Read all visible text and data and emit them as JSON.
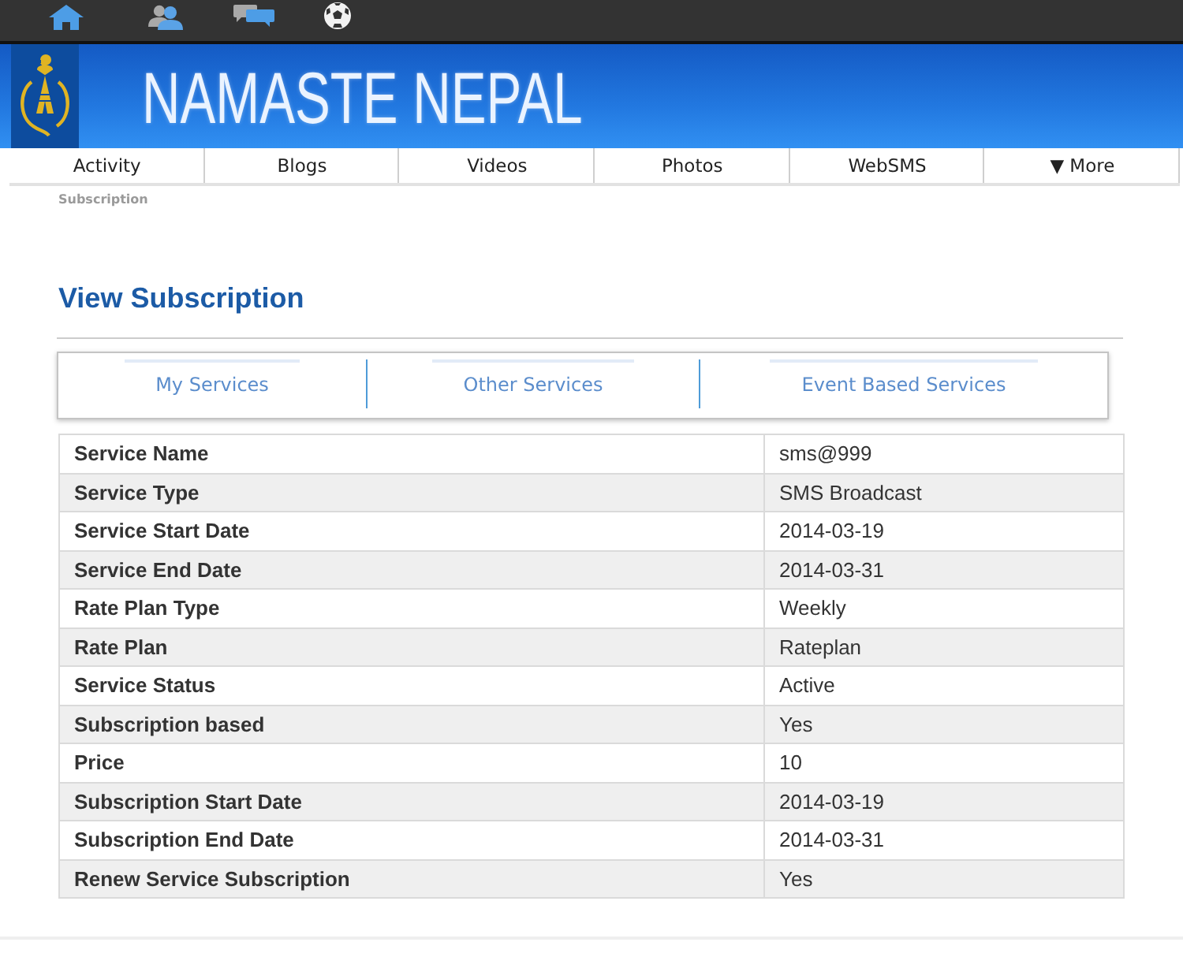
{
  "header": {
    "site_title": "NAMASTE NEPAL"
  },
  "nav": {
    "items": [
      {
        "label": "Activity"
      },
      {
        "label": "Blogs"
      },
      {
        "label": "Videos"
      },
      {
        "label": "Photos"
      },
      {
        "label": "WebSMS"
      },
      {
        "label": "▼ More"
      }
    ]
  },
  "breadcrumb": "Subscription",
  "page_title": "View Subscription",
  "service_tabs": [
    {
      "label": "My Services"
    },
    {
      "label": "Other Services"
    },
    {
      "label": "Event Based Services"
    }
  ],
  "details_table": {
    "rows": [
      {
        "label": "Service Name",
        "value": "sms@999"
      },
      {
        "label": "Service Type",
        "value": "SMS Broadcast"
      },
      {
        "label": "Service Start Date",
        "value": "2014-03-19"
      },
      {
        "label": "Service End Date",
        "value": "2014-03-31"
      },
      {
        "label": "Rate Plan Type",
        "value": "Weekly"
      },
      {
        "label": "Rate Plan",
        "value": "Rateplan"
      },
      {
        "label": "Service Status",
        "value": "Active"
      },
      {
        "label": "Subscription based",
        "value": "Yes"
      },
      {
        "label": "Price",
        "value": "10"
      },
      {
        "label": "Subscription Start Date",
        "value": "2014-03-19"
      },
      {
        "label": "Subscription End Date",
        "value": "2014-03-31"
      },
      {
        "label": "Renew Service Subscription",
        "value": "Yes"
      }
    ]
  }
}
